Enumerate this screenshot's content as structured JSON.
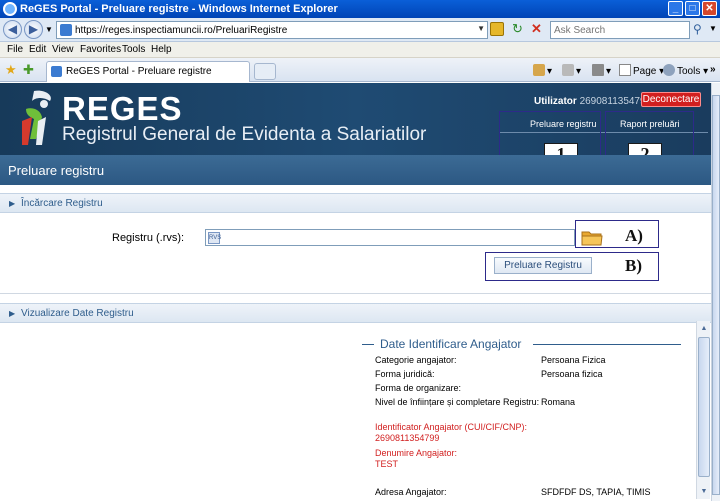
{
  "window": {
    "title": "ReGES Portal - Preluare registre - Windows Internet Explorer",
    "minimize": "_",
    "maximize": "□",
    "close": "✕"
  },
  "addressbar": {
    "url": "https://reges.inspectiamuncii.ro/PreluariRegistre",
    "search_placeholder": "Ask Search"
  },
  "menu": [
    "File",
    "Edit",
    "View",
    "Favorites",
    "Tools",
    "Help"
  ],
  "tabbar": {
    "tab_label": "ReGES Portal - Preluare registre",
    "page_label": "Page",
    "tools_label": "Tools",
    "more": "»"
  },
  "header": {
    "logo_title": "REGES",
    "logo_subtitle": "Registrul General de Evidenta a Salariatilor",
    "user_label": "Utilizator",
    "user_id": "2690811354799",
    "logout_label": "Deconectare",
    "nav_tabs": [
      "Preluare registru",
      "Raport preluări"
    ]
  },
  "annotations": {
    "box1": "1",
    "box2": "2",
    "labelA": "A)",
    "labelB": "B)"
  },
  "page": {
    "title": "Preluare registru",
    "upload_section": "Încărcare Registru",
    "register_label": "Registru (.rvs):",
    "file_icon_text": "RVS",
    "upload_button": "Preluare Registru",
    "view_section": "Vizualizare Date Registru"
  },
  "employer": {
    "heading": "Date Identificare Angajator",
    "fields": [
      {
        "label": "Categorie angajator:",
        "value": "Persoana Fizica"
      },
      {
        "label": "Forma juridică:",
        "value": "Persoana fizica"
      },
      {
        "label": "Forma de organizare:",
        "value": ""
      },
      {
        "label": "Nivel de înființare și completare Registru:",
        "value": "Romana"
      }
    ],
    "id_label": "Identificator Angajator (CUI/CIF/CNP):",
    "id_value": "2690811354799",
    "name_label": "Denumire Angajator:",
    "name_value": "TEST",
    "address_label": "Adresa Angajator:",
    "address_value": "SFDFDF DS, TAPIA, TIMIS"
  },
  "colors": {
    "header_bg": "#1f4b73",
    "title_bar_bg": "#2c5883",
    "accent_red": "#d11f1f",
    "section_text": "#2f5d8c"
  }
}
